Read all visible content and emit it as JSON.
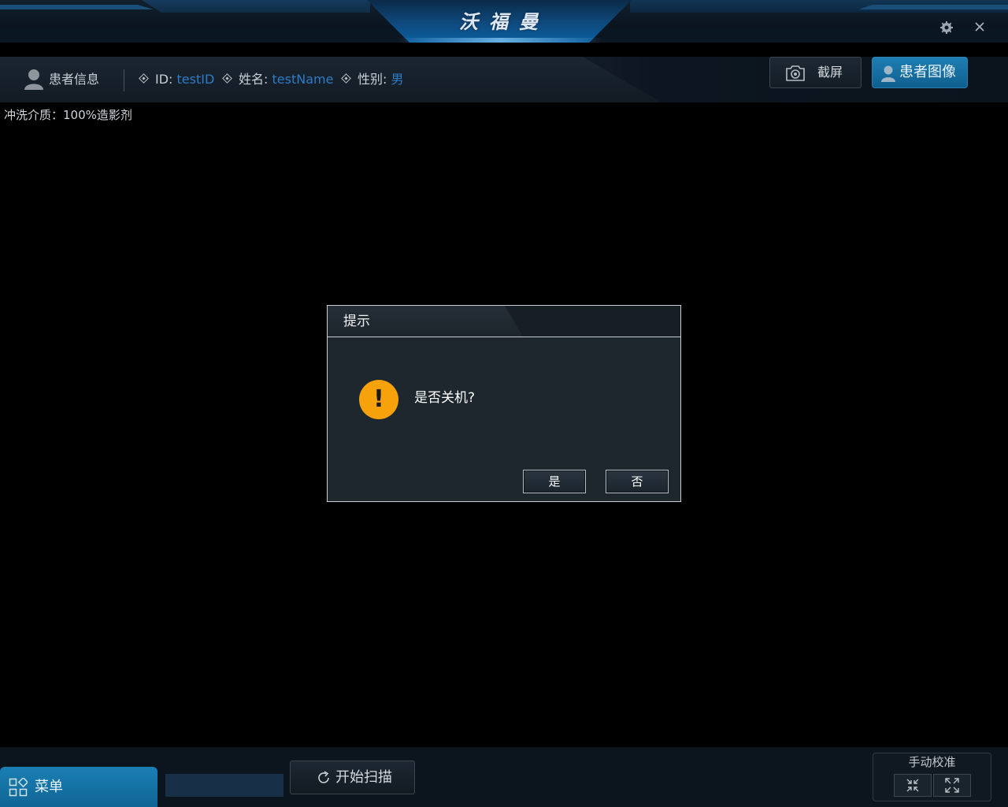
{
  "app": {
    "logo_text": "沃福曼"
  },
  "titlebar": {
    "settings_icon": "gear-icon",
    "close_icon": "close-icon"
  },
  "patient": {
    "section_label": "患者信息",
    "id_label": "ID:",
    "id_value": "testID",
    "name_label": "姓名:",
    "name_value": "testName",
    "gender_label": "性别:",
    "gender_value": "男"
  },
  "toolbar": {
    "screenshot_label": "截屏",
    "patient_image_label": "患者图像"
  },
  "info": {
    "flush_medium": "冲洗介质：100%造影剂"
  },
  "dialog": {
    "title": "提示",
    "message": "是否关机?",
    "icon": "warning-icon",
    "yes_label": "是",
    "no_label": "否"
  },
  "bottom": {
    "menu_label": "菜单",
    "scan_label": "开始扫描",
    "calibration_title": "手动校准"
  },
  "colors": {
    "accent": "#1a7fb4",
    "value_text": "#2e7cc6",
    "warning": "#f7a20b",
    "background": "#000000"
  }
}
